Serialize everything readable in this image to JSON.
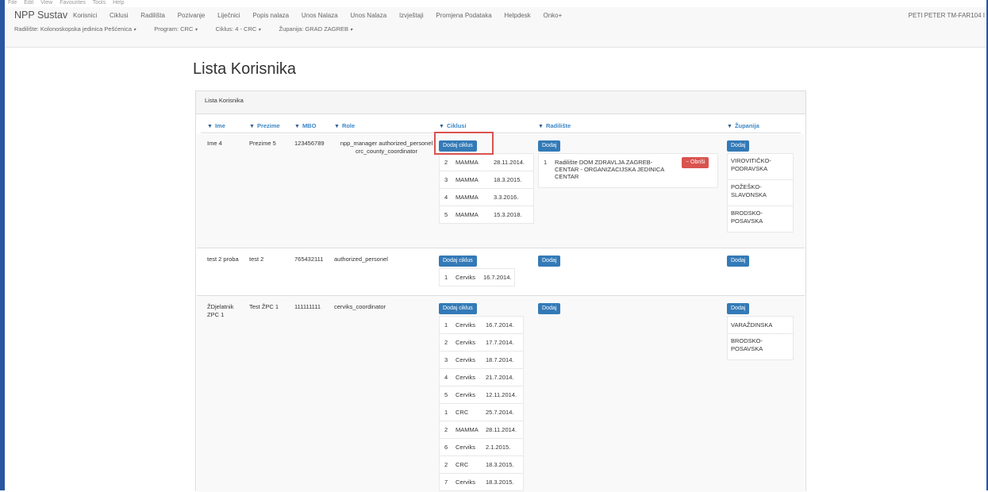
{
  "browser_menu": [
    "File",
    "Edit",
    "View",
    "Favourites",
    "Tools",
    "Help"
  ],
  "nav": {
    "brand": "NPP Sustav",
    "links": [
      "Korisnici",
      "Ciklusi",
      "Radilišta",
      "Pozivanje",
      "Liječnici",
      "Popis nalaza",
      "Unos Nalaza",
      "Unos Nalaza",
      "Izvještaji",
      "Promjena Podataka",
      "Helpdesk",
      "Onko+"
    ],
    "user": "PETI PETER TM-FAR104 I",
    "sub": {
      "radiliste": "Radilište: Kolonoskopska jedinica Pešćenica",
      "program": "Program: CRC",
      "ciklus": "Ciklus: 4 - CRC",
      "zupanija": "Županija: GRAD ZAGREB"
    }
  },
  "page_title": "Lista Korisnika",
  "panel_title": "Lista Korisnika",
  "columns": [
    "Ime",
    "Prezime",
    "MBO",
    "Role",
    "Ciklusi",
    "Radilište",
    "Županija"
  ],
  "buttons": {
    "dodaj_ciklus": "Dodaj ciklus",
    "dodaj": "Dodaj",
    "obrisi": "− Obriši"
  },
  "users": [
    {
      "ime": "Ime 4",
      "prezime": "Prezime 5",
      "mbo": "123456789",
      "role": "npp_manager  authorized_personel crc_county_coordinator",
      "ciklusi": [
        {
          "n": "2",
          "type": "MAMMA",
          "date": "28.11.2014."
        },
        {
          "n": "3",
          "type": "MAMMA",
          "date": "18.3.2015."
        },
        {
          "n": "4",
          "type": "MAMMA",
          "date": "3.3.2016."
        },
        {
          "n": "5",
          "type": "MAMMA",
          "date": "15.3.2018."
        }
      ],
      "radiliste": [
        {
          "n": "1",
          "name": "Radilište DOM ZDRAVLJA ZAGREB-CENTAR - ORGANIZACIJSKA JEDINICA CENTAR"
        }
      ],
      "zupanije": [
        "VIROVITIČKO-PODRAVSKA",
        "POŽEŠKO-SLAVONSKA",
        "BRODSKO-POSAVSKA"
      ]
    },
    {
      "ime": "test 2 proba",
      "prezime": "test 2",
      "mbo": "765432111",
      "role": "authorized_personel",
      "ciklusi": [
        {
          "n": "1",
          "type": "Cerviks",
          "date": "16.7.2014."
        }
      ],
      "radiliste": [],
      "zupanije": []
    },
    {
      "ime": "ŽDjelatnik ZPC 1",
      "prezime": "Test ŽPC 1",
      "mbo": "111111111",
      "role": "cerviks_coordinator",
      "ciklusi": [
        {
          "n": "1",
          "type": "Cerviks",
          "date": "16.7.2014."
        },
        {
          "n": "2",
          "type": "Cerviks",
          "date": "17.7.2014."
        },
        {
          "n": "3",
          "type": "Cerviks",
          "date": "18.7.2014."
        },
        {
          "n": "4",
          "type": "Cerviks",
          "date": "21.7.2014."
        },
        {
          "n": "5",
          "type": "Cerviks",
          "date": "12.11.2014."
        },
        {
          "n": "1",
          "type": "CRC",
          "date": "25.7.2014."
        },
        {
          "n": "2",
          "type": "MAMMA",
          "date": "28.11.2014."
        },
        {
          "n": "6",
          "type": "Cerviks",
          "date": "2.1.2015."
        },
        {
          "n": "2",
          "type": "CRC",
          "date": "18.3.2015."
        },
        {
          "n": "7",
          "type": "Cerviks",
          "date": "18.3.2015."
        }
      ],
      "radiliste": [],
      "zupanije": [
        "VARAŽDINSKA",
        "BRODSKO-POSAVSKA"
      ]
    }
  ]
}
